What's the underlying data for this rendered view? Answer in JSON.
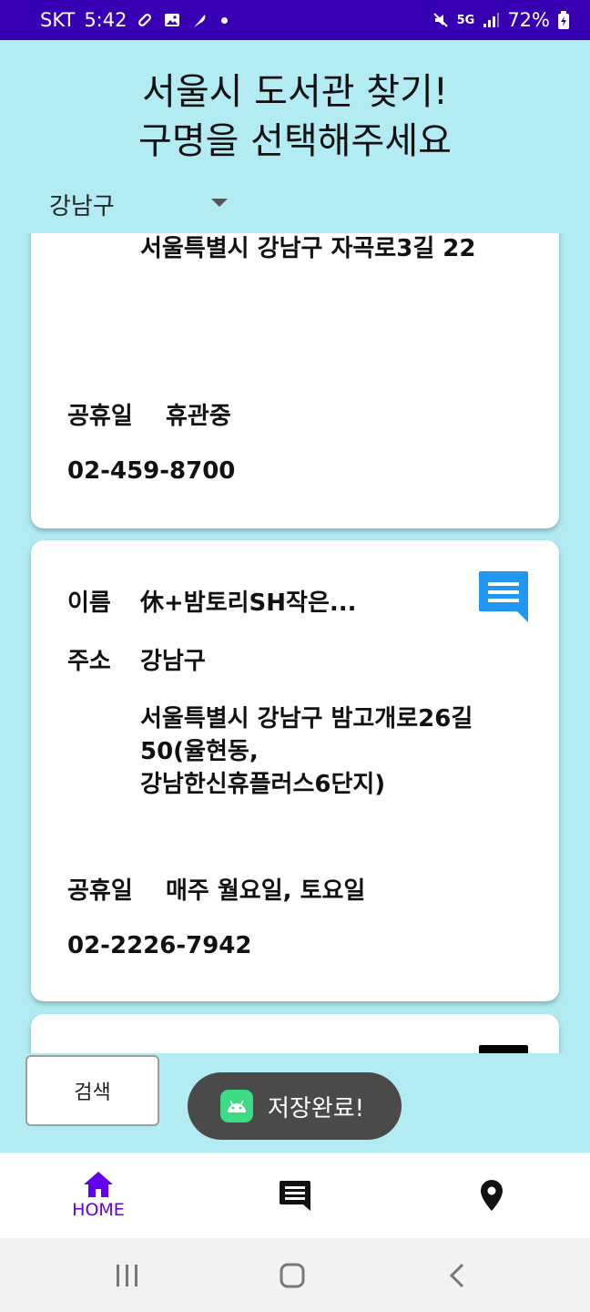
{
  "status_bar": {
    "carrier": "SKT",
    "time": "5:42",
    "network": "5G",
    "battery": "72%"
  },
  "header": {
    "title_line1": "서울시 도서관 찾기!",
    "title_line2": "구명을 선택해주세요"
  },
  "district_spinner": {
    "selected": "강남구"
  },
  "cards": [
    {
      "address_detail": "서울특별시 강남구 자곡로3길 22",
      "closed_label": "공휴일",
      "closed_value": "휴관중",
      "phone": "02-459-8700"
    },
    {
      "name_label": "이름",
      "name_value": "休+밤토리SH작은...",
      "address_label": "주소",
      "address_value": "강남구",
      "address_detail_line1": "서울특별시 강남구 밤고개로26길",
      "address_detail_line2": "50(율현동,",
      "address_detail_line3": "강남한신휴플러스6단지)",
      "closed_label": "공휴일",
      "closed_value": "매주 월요일, 토요일",
      "phone": "02-2226-7942"
    }
  ],
  "search_button": {
    "label": "검색"
  },
  "toast": {
    "text": "저장완료!"
  },
  "bottom_nav": {
    "home_label": "HOME",
    "accent": "#6200ee"
  },
  "colors": {
    "status_bar": "#3700b3",
    "background": "#b2ebf2",
    "message_icon": "#2196f3"
  }
}
